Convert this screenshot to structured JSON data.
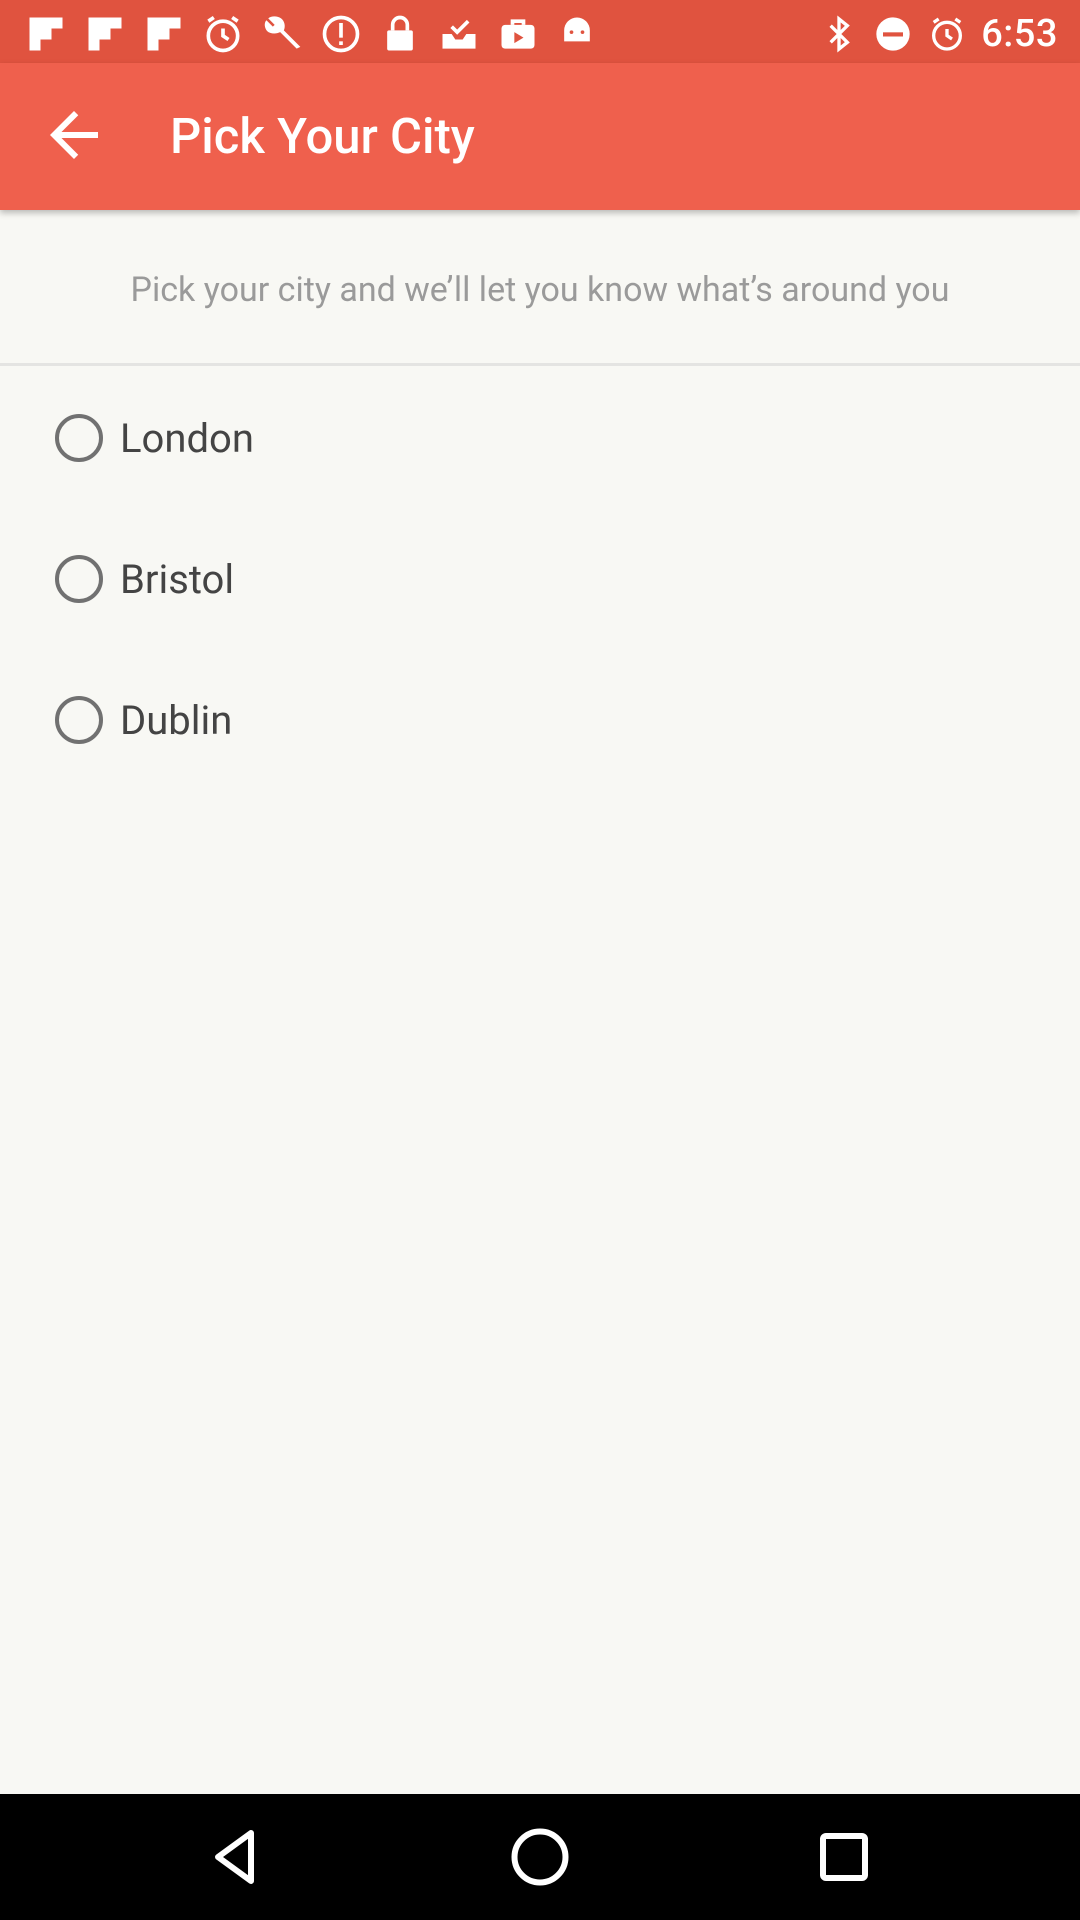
{
  "status_bar": {
    "time": "6:53",
    "icons": [
      "flipboard-icon",
      "flipboard-icon",
      "flipboard-icon",
      "alarm-icon",
      "wrench-icon",
      "alert-icon",
      "lock-icon",
      "inbox-check-icon",
      "briefcase-icon",
      "android-icon"
    ],
    "right_icons": [
      "bluetooth-icon",
      "do-not-disturb-icon",
      "alarm-icon"
    ]
  },
  "app_bar": {
    "title": "Pick Your City",
    "back_icon": "arrow-back-icon",
    "color": "#ef604d"
  },
  "subtitle": "Pick your city and we’ll let you know what’s around you",
  "cities": [
    {
      "label": "London",
      "selected": false
    },
    {
      "label": "Bristol",
      "selected": false
    },
    {
      "label": "Dublin",
      "selected": false
    }
  ],
  "nav_bar": {
    "buttons": [
      "back-triangle-icon",
      "home-circle-icon",
      "recents-square-icon"
    ]
  }
}
